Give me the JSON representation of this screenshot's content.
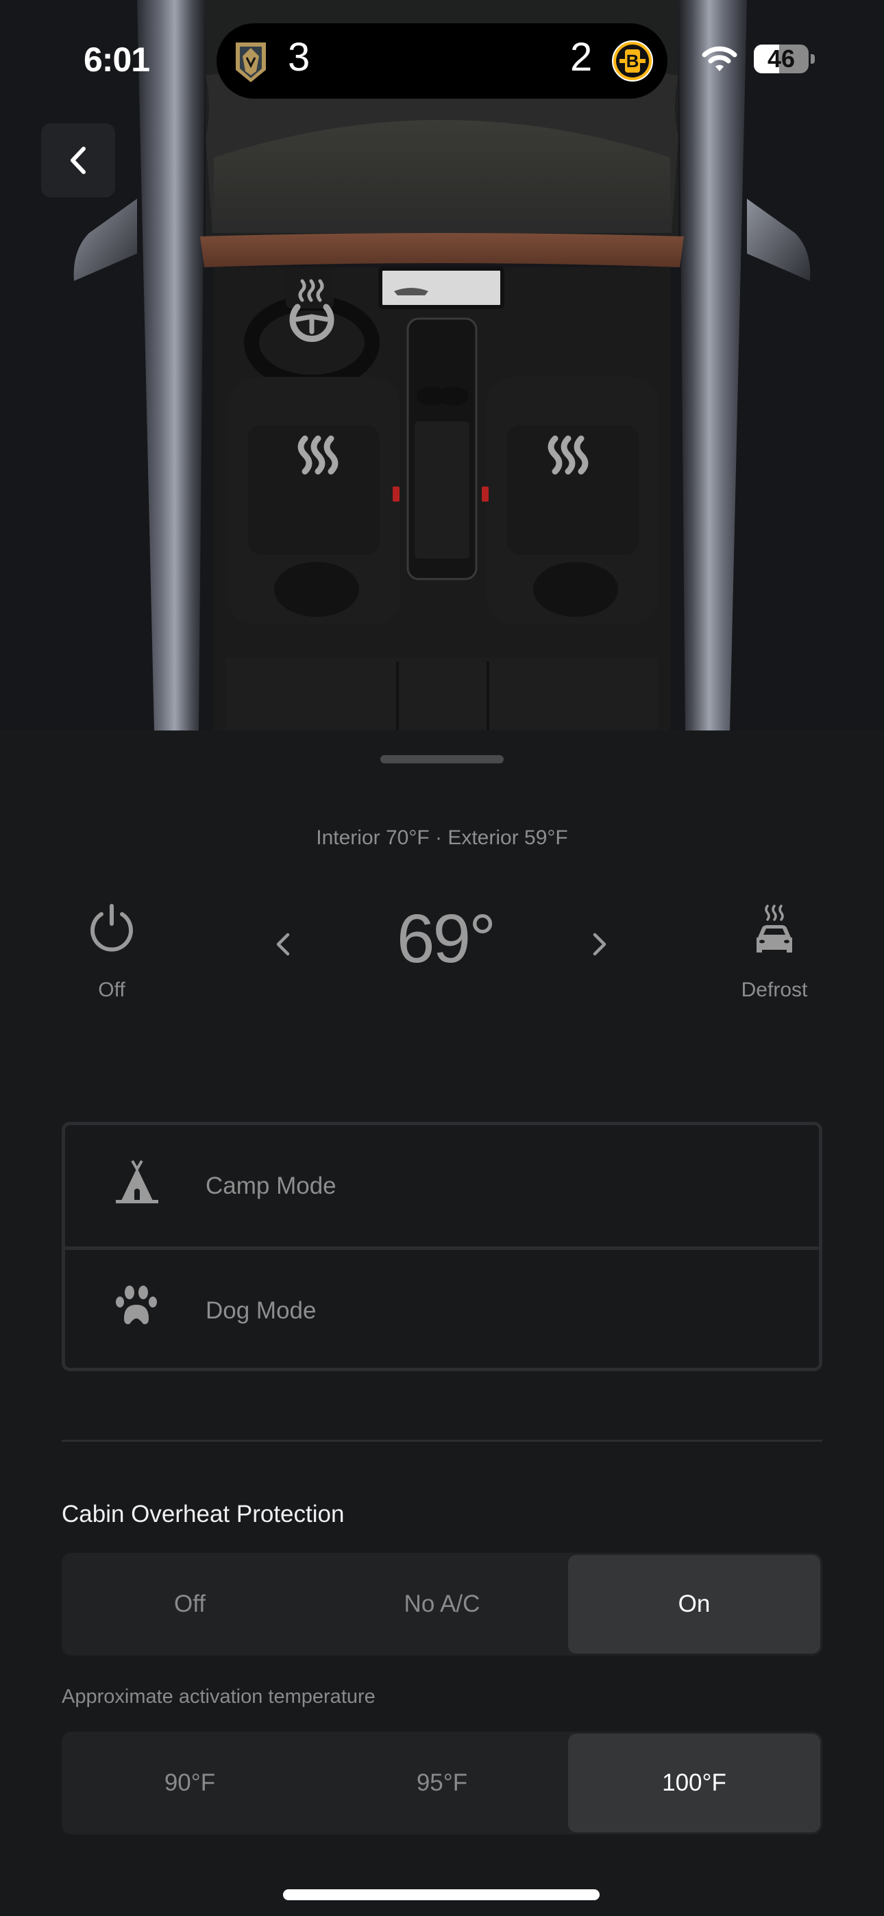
{
  "status_bar": {
    "time": "6:01",
    "live_activity": {
      "home_team": "Vegas Golden Knights",
      "home_score": "3",
      "away_team": "Boston Bruins",
      "away_score": "2"
    },
    "wifi_icon": "wifi-icon",
    "battery_level": "46",
    "battery_fraction": 0.46
  },
  "nav": {
    "back_icon": "chevron-left-icon"
  },
  "car_view": {
    "heated_steering": true,
    "heated_seat_driver": true,
    "heated_seat_passenger": true,
    "icons": [
      "heated-steering-wheel-icon",
      "heated-seat-icon",
      "heated-seat-icon"
    ]
  },
  "climate": {
    "readout": "Interior 70°F · Exterior 59°F",
    "interior_temp": "70°F",
    "exterior_temp": "59°F",
    "power_label": "Off",
    "power_icon": "power-icon",
    "set_temp": "69°",
    "decrease_icon": "chevron-left-icon",
    "increase_icon": "chevron-right-icon",
    "defrost_label": "Defrost",
    "defrost_icon": "defrost-car-icon"
  },
  "modes": [
    {
      "label": "Camp Mode",
      "icon": "tent-icon"
    },
    {
      "label": "Dog Mode",
      "icon": "paw-icon"
    }
  ],
  "cabin_overheat": {
    "title": "Cabin Overheat Protection",
    "options": [
      "Off",
      "No A/C",
      "On"
    ],
    "selected": "On",
    "activation_label": "Approximate activation temperature",
    "activation_options": [
      "90°F",
      "95°F",
      "100°F"
    ],
    "activation_selected": "100°F"
  },
  "colors": {
    "background": "#18191b",
    "segment_bg": "#212224",
    "segment_selected": "#353638",
    "muted_text": "#8e8e8e",
    "interior_wood": "#6b4331",
    "vgk_gold": "#b4975a",
    "bos_gold": "#fcb514"
  }
}
